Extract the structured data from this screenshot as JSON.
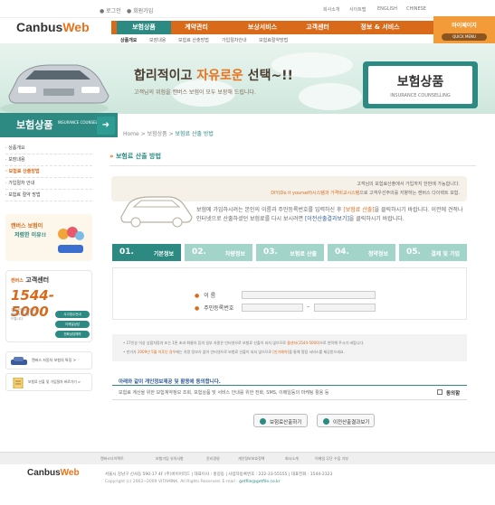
{
  "site": {
    "logo_main": "Canbus",
    "logo_accent": "Web"
  },
  "top_links": {
    "login": "로그인",
    "join": "회원가입"
  },
  "util_links": [
    "회사소개",
    "사이트맵",
    "ENGLISH",
    "CHINESE"
  ],
  "nav": [
    "보험상품",
    "계약관리",
    "보상서비스",
    "고객센터",
    "정보 & 서비스"
  ],
  "my_page": {
    "label": "마이페이지",
    "quick": "QUICK MENU"
  },
  "subnav": [
    "상품개요",
    "보장내용",
    "보험료 산출방법",
    "가입절차안내",
    "보험료절약방법"
  ],
  "hero": {
    "title_a": "합리적이고 ",
    "title_b": "자유로운",
    "title_c": " 선택~!!",
    "subtitle": "고객님의 위험을 캔버스 보험이 모두 보장해 드립니다."
  },
  "badge": {
    "title": "보험상품",
    "subtitle": "INSURANCE COUNSELLING"
  },
  "side": {
    "head_title": "보험상품",
    "head_sub": "INSURANCE COUNSELLING",
    "menu": [
      "상품개요",
      "보장내용",
      "보험료 산출방법",
      "가입절차 안내",
      "보험료 절약 방법"
    ],
    "promo_a": "캔버스 보험이",
    "promo_b": "저렴한 이유!!"
  },
  "call_center": {
    "title_a": "캔버스",
    "title_b": "고객센터",
    "number": "1544-5000",
    "desc": "지금 전화주시면 저렴한 보험료를 알려드립니다.",
    "buttons": [
      "사고접수안내",
      "이메일상담",
      "전화상담예약"
    ]
  },
  "banners": [
    "캔버스 자동차 보험의 특징 >",
    "보험료 산출 및 가입절차 바로가기 >"
  ],
  "breadcrumb": [
    "Home",
    "보험상품",
    "보험료 산출 방법"
  ],
  "section_title": "보험료 산출 방법",
  "notice": {
    "line1": "고객님의 보험료산출에서 가입까지 한번에 가능합니다.",
    "line2_pre": "DIY(Do it yourself)시스템과 가격비교시스템",
    "line2_post": "으로 고객우선주의를 지향하는 캔버스 다이렉트 보험."
  },
  "intro": {
    "p1": "보험에 가입하시려는 본인의 이름과 주민등록번호를 입력하신 후 ",
    "btn1": "[보험료 산출]",
    "p2": "을 클릭하시기 바랍니다. 이전에 견적나 인터넷으로 산출하셨던 보험료를 다시 보시려면 ",
    "btn2": "[이전산출결과보기]",
    "p3": "을 클릭하시기 바랍니다."
  },
  "steps": [
    {
      "num": "01.",
      "label": "기본정보"
    },
    {
      "num": "02.",
      "label": "차량정보"
    },
    {
      "num": "03.",
      "label": "보험료 산출"
    },
    {
      "num": "04.",
      "label": "청약정보"
    },
    {
      "num": "05.",
      "label": "결제 및 가입"
    }
  ],
  "form": {
    "name_label": "이      름",
    "rrn_label": "주민등록번호",
    "dash": "–"
  },
  "notes": {
    "n1_pre": "17인승 이상 승합차량과 또는 1톤 초과 화물차 등의 일부 차종은 인터넷으로 보험료 산출이 되지 않으므로 ",
    "n1_phone": "콜센터(1544-5000)",
    "n1_post": "으로 연락해 주시기 바랍니다.",
    "n2_pre": "만기가 ",
    "n2_hl": "2009년 5월 이후인 경우",
    "n2_mid": "에는 차량 정보가 없어 인터넷으로 보험료 산출이 되지 않으므로 ",
    "n2_hl2": "[만기예약]",
    "n2_post": "을 통해 알림 서비스를 제공받으세요."
  },
  "agree": {
    "title": "아래와 같이 개인정보제공 및 활용에 동의합니다.",
    "body": "보험료 계산을 위한 보험계약정보 조회, 보험상품 및 서비스 안내를 위한 전화, SMS, 이메일등의 마케팅 활용 등",
    "checkbox_label": "동의함"
  },
  "buttons": {
    "calc": "보험료산출하기",
    "prev": "이전산출결과보기"
  },
  "footer": {
    "links": [
      "캔버스다이렉트",
      "보험가입 유의사항",
      "윤리경영",
      "개인정보보호정책",
      "회사소개",
      "이메일 무단 수집 거부"
    ],
    "logo_main": "Canbus",
    "logo_accent": "Web",
    "address": "서울시 강남구 신사동 590-17 4F (주)바이어리드  |  대표이사 : 홍길동  |  사업자등록번호 : 222-33-55555  |  대표전화 : 1544-2323",
    "copy_pre": "Copyright (c) 2002~2009 VITAMINK. All Rights Reserved.  E-mail : ",
    "copy_mail": "getfile@getfile.co.kr"
  }
}
